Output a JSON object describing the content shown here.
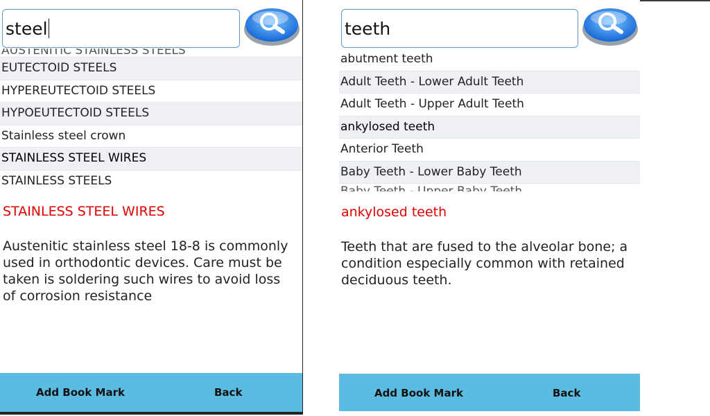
{
  "left": {
    "search": {
      "value": "steel"
    },
    "list_partial_top": "AUSTENITIC STAINLESS STEELS",
    "list": [
      "EUTECTOID STEELS",
      "HYPEREUTECTOID STEELS",
      "HYPOEUTECTOID STEELS",
      "Stainless steel crown",
      "STAINLESS STEEL WIRES",
      "STAINLESS STEELS"
    ],
    "definition_title": "STAINLESS STEEL WIRES",
    "definition_body": "Austenitic stainless steel 18-8 is commonly used in orthodontic devices. Care must be taken is soldering such wires to avoid loss of corrosion resistance",
    "add_bookmark_label": "Add Book Mark",
    "back_label": "Back"
  },
  "right": {
    "search": {
      "value": "teeth"
    },
    "list": [
      "abutment teeth",
      "Adult Teeth - Lower Adult Teeth",
      "Adult Teeth - Upper Adult Teeth",
      "ankylosed teeth",
      "Anterior Teeth",
      "Baby Teeth - Lower Baby Teeth"
    ],
    "list_partial_bottom": "Baby Teeth - Upper Baby Teeth",
    "definition_title": "ankylosed teeth",
    "definition_body": "Teeth that are fused to the alveolar bone; a condition especially common with retained deciduous teeth.",
    "add_bookmark_label": "Add Book Mark",
    "back_label": "Back"
  },
  "colors": {
    "accent_bar": "#5bbbe0",
    "definition_title": "#e00000",
    "input_border": "#5b9bd5"
  },
  "icons": {
    "search_button": "magnifier-icon"
  }
}
